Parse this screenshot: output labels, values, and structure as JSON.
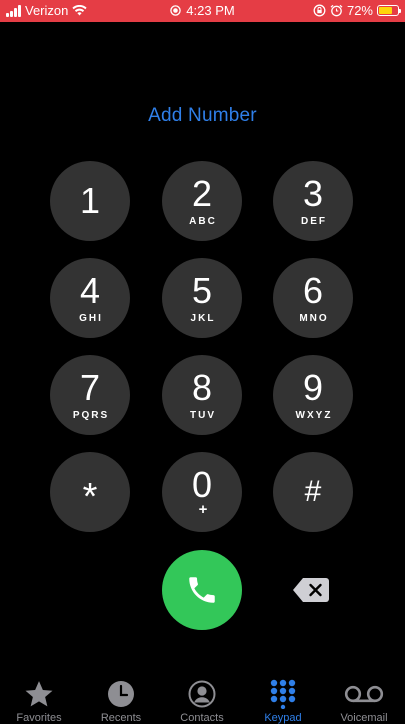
{
  "status_bar": {
    "carrier": "Verizon",
    "time": "4:23 PM",
    "battery_percent": "72%",
    "battery_level": 0.72,
    "icons": [
      "signal-icon",
      "wifi-icon",
      "screen-record-icon",
      "lock-rotation-icon",
      "alarm-icon",
      "battery-icon"
    ],
    "background_color": "#e53d45"
  },
  "add_number": "Add Number",
  "keypad": {
    "keys": [
      {
        "digit": "1",
        "letters": ""
      },
      {
        "digit": "2",
        "letters": "ABC"
      },
      {
        "digit": "3",
        "letters": "DEF"
      },
      {
        "digit": "4",
        "letters": "GHI"
      },
      {
        "digit": "5",
        "letters": "JKL"
      },
      {
        "digit": "6",
        "letters": "MNO"
      },
      {
        "digit": "7",
        "letters": "PQRS"
      },
      {
        "digit": "8",
        "letters": "TUV"
      },
      {
        "digit": "9",
        "letters": "WXYZ"
      },
      {
        "digit": "*",
        "letters": ""
      },
      {
        "digit": "0",
        "letters": "+"
      },
      {
        "digit": "#",
        "letters": ""
      }
    ]
  },
  "call_button": {
    "icon": "phone-icon",
    "color": "#33c759"
  },
  "delete_button": {
    "icon": "backspace-icon"
  },
  "tab_bar": {
    "tabs": [
      {
        "label": "Favorites",
        "icon": "star-icon",
        "active": false
      },
      {
        "label": "Recents",
        "icon": "clock-icon",
        "active": false
      },
      {
        "label": "Contacts",
        "icon": "person-circle-icon",
        "active": false
      },
      {
        "label": "Keypad",
        "icon": "keypad-grid-icon",
        "active": true
      },
      {
        "label": "Voicemail",
        "icon": "voicemail-icon",
        "active": false
      }
    ],
    "active_color": "#2f7fe8",
    "inactive_color": "#8e8e93"
  }
}
